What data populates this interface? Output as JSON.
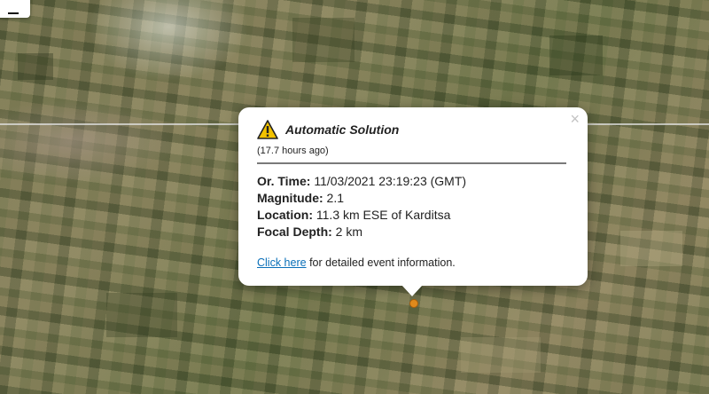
{
  "map": {
    "menu_icon": "hamburger-icon",
    "marker_color": "#e08a1c"
  },
  "popup": {
    "warning_icon": "warning-triangle-icon",
    "title": "Automatic Solution",
    "time_ago": "(17.7 hours ago)",
    "close_glyph": "×",
    "fields": {
      "origin_time_label": "Or. Time:",
      "origin_time_value": "11/03/2021 23:19:23 (GMT)",
      "magnitude_label": "Magnitude:",
      "magnitude_value": "2.1",
      "location_label": "Location:",
      "location_value": "11.3 km ESE of Karditsa",
      "depth_label": "Focal Depth:",
      "depth_value": "2 km"
    },
    "link_text": "Click here",
    "link_suffix": "for detailed event information."
  }
}
